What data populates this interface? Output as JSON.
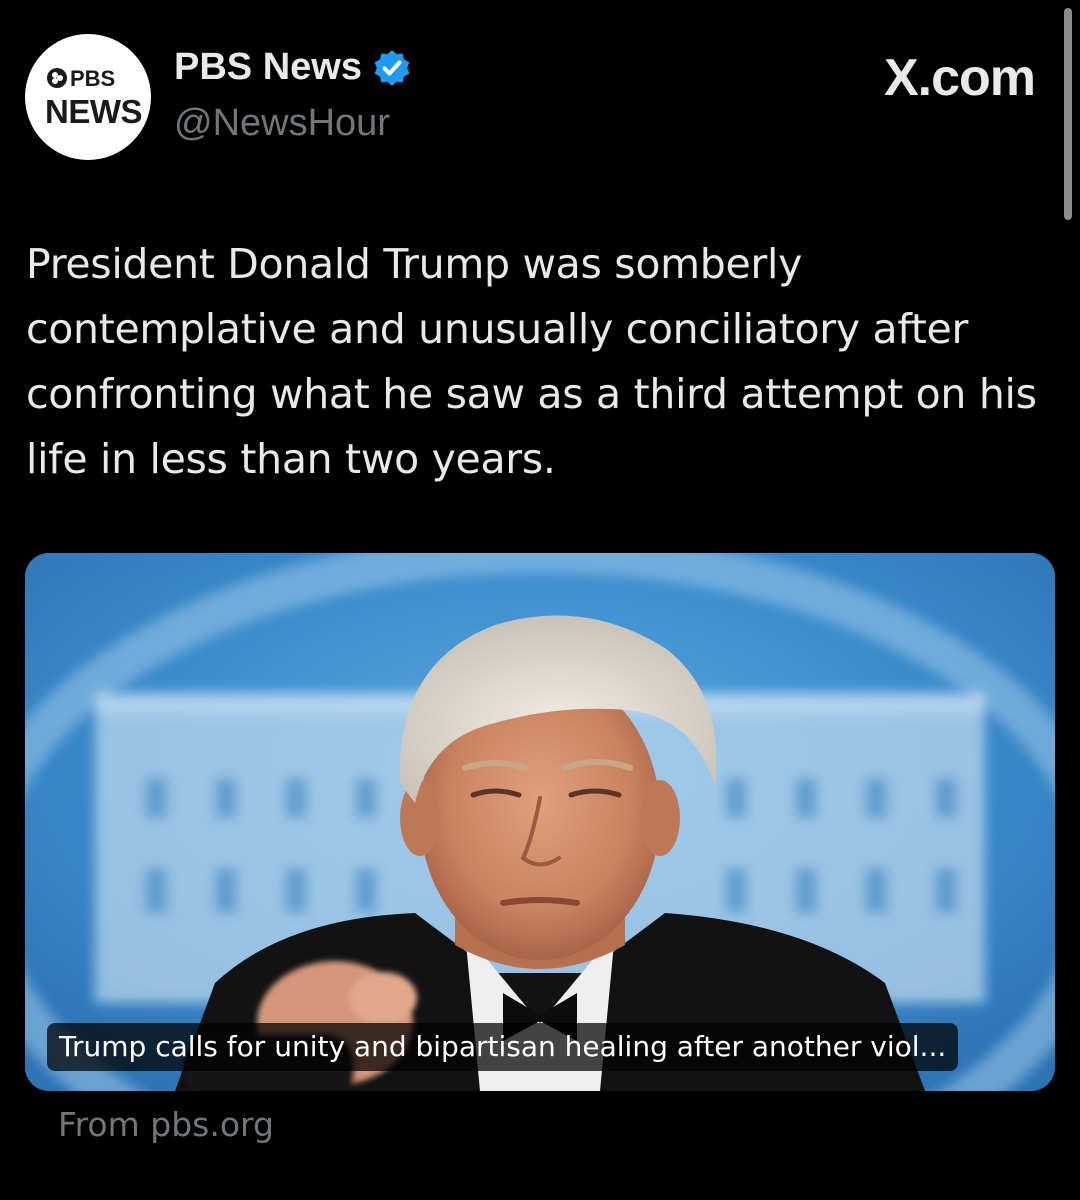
{
  "account": {
    "logo_line1": "PBS",
    "logo_line2": "NEWS",
    "display_name": "PBS News",
    "handle": "@NewsHour",
    "verified": true
  },
  "site_label": "X.com",
  "tweet": {
    "text": "President Donald Trump was somberly contemplative and unusually conciliatory after confronting what he saw as a third attempt on his life in less than two years."
  },
  "link_card": {
    "caption": "Trump calls for unity and bipartisan healing after another viol...",
    "source": "From pbs.org"
  },
  "colors": {
    "background": "#000000",
    "primary_text": "#e7e9ea",
    "secondary_text": "#71767b",
    "verified_blue": "#1d9bf0",
    "card_sky_blue": "#3d8fcf"
  },
  "icons": {
    "verified": "verified-badge-icon",
    "logo": "pbs-news-logo"
  }
}
